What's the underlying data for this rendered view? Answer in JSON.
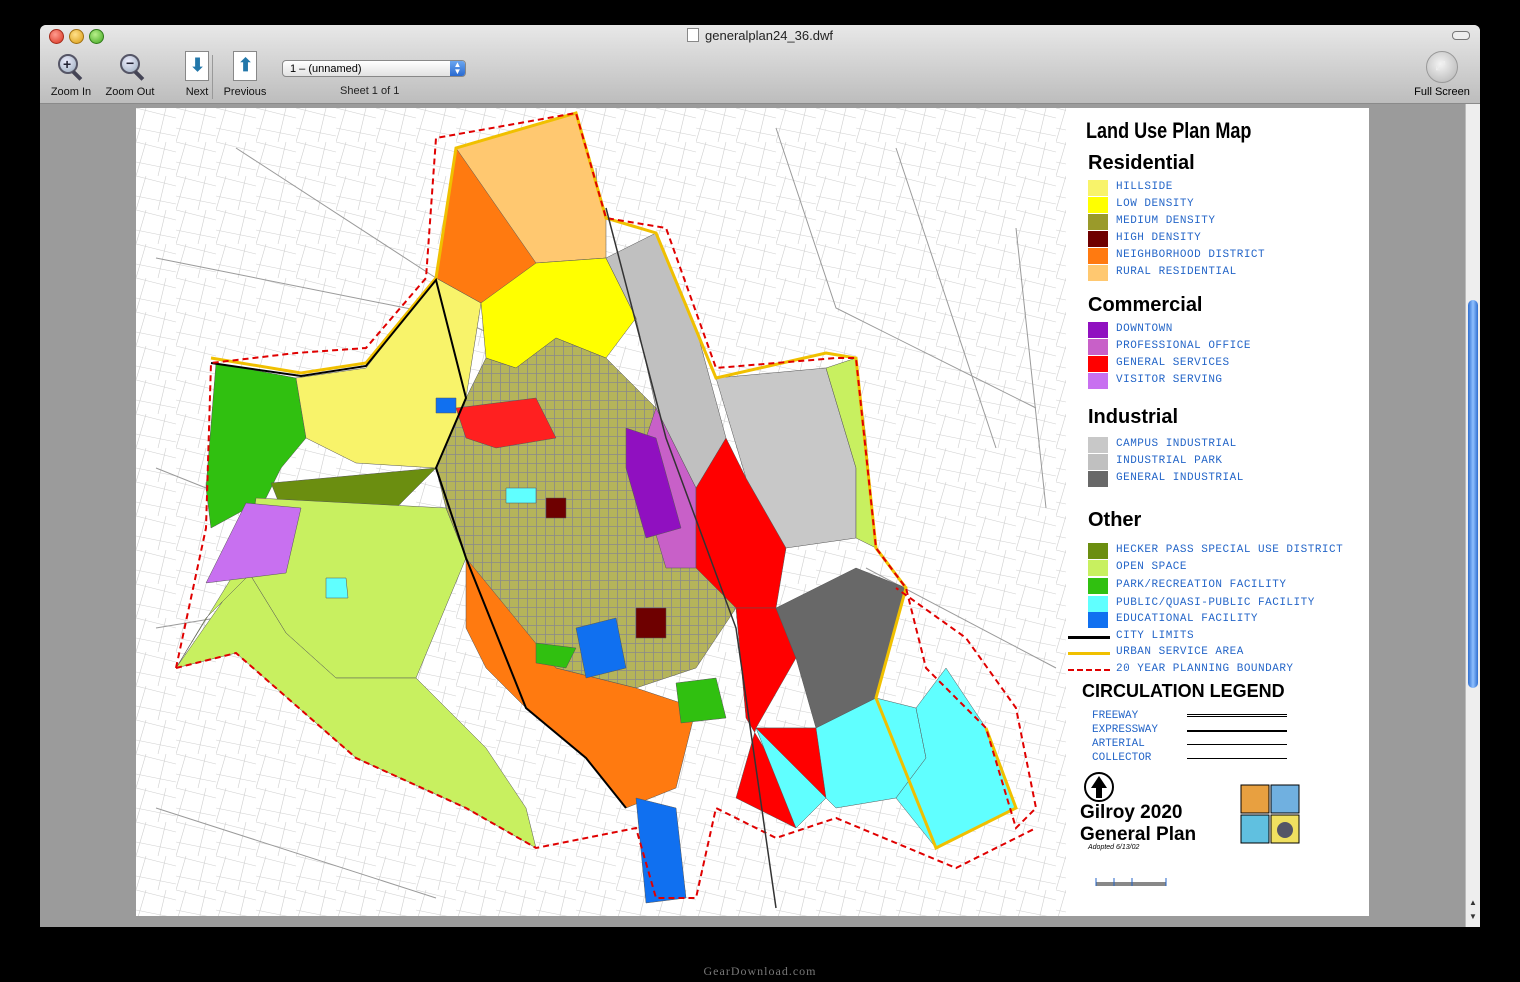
{
  "window": {
    "title": "generalplan24_36.dwf"
  },
  "toolbar": {
    "zoom_in": "Zoom In",
    "zoom_out": "Zoom Out",
    "next": "Next",
    "previous": "Previous",
    "sheet_select": "1 – (unnamed)",
    "sheet_info": "Sheet 1 of 1",
    "full_screen": "Full Screen"
  },
  "legend": {
    "title": "Land Use Plan Map",
    "residential": {
      "heading": "Residential",
      "items": [
        {
          "label": "HILLSIDE",
          "color": "#f8f36a"
        },
        {
          "label": "LOW DENSITY",
          "color": "#ffff00"
        },
        {
          "label": "MEDIUM DENSITY",
          "color": "#9a9a2a"
        },
        {
          "label": "HIGH DENSITY",
          "color": "#6e0000"
        },
        {
          "label": "NEIGHBORHOOD DISTRICT",
          "color": "#ff7a10"
        },
        {
          "label": "RURAL RESIDENTIAL",
          "color": "#ffc870"
        }
      ]
    },
    "commercial": {
      "heading": "Commercial",
      "items": [
        {
          "label": "DOWNTOWN",
          "color": "#9010c0"
        },
        {
          "label": "PROFESSIONAL OFFICE",
          "color": "#c860c8"
        },
        {
          "label": "GENERAL SERVICES",
          "color": "#ff0000"
        },
        {
          "label": "VISITOR SERVING",
          "color": "#c870f0"
        }
      ]
    },
    "industrial": {
      "heading": "Industrial",
      "items": [
        {
          "label": "CAMPUS INDUSTRIAL",
          "color": "#c8c8c8"
        },
        {
          "label": "INDUSTRIAL PARK",
          "color": "#c0c0c0"
        },
        {
          "label": "GENERAL INDUSTRIAL",
          "color": "#686868"
        }
      ]
    },
    "other": {
      "heading": "Other",
      "items": [
        {
          "label": "HECKER PASS SPECIAL USE DISTRICT",
          "color": "#6b8e10"
        },
        {
          "label": "OPEN SPACE",
          "color": "#c8f060"
        },
        {
          "label": "PARK/RECREATION FACILITY",
          "color": "#30c010"
        },
        {
          "label": "PUBLIC/QUASI-PUBLIC FACILITY",
          "color": "#60ffff"
        },
        {
          "label": "EDUCATIONAL FACILITY",
          "color": "#1070f0"
        }
      ],
      "lines": [
        {
          "label": "CITY LIMITS",
          "color": "#000000",
          "style": "solid"
        },
        {
          "label": "URBAN SERVICE AREA",
          "color": "#f0c000",
          "style": "solid"
        },
        {
          "label": "20 YEAR PLANNING BOUNDARY",
          "color": "#e00000",
          "style": "dashed"
        }
      ]
    },
    "circulation": {
      "heading": "CIRCULATION LEGEND",
      "items": [
        "FREEWAY",
        "EXPRESSWAY",
        "ARTERIAL",
        "COLLECTOR"
      ]
    },
    "plan_title_1": "Gilroy 2020",
    "plan_title_2": "General Plan",
    "adopted": "Adopted 6/13/02"
  },
  "footer": {
    "watermark": "GearDownload.com"
  }
}
